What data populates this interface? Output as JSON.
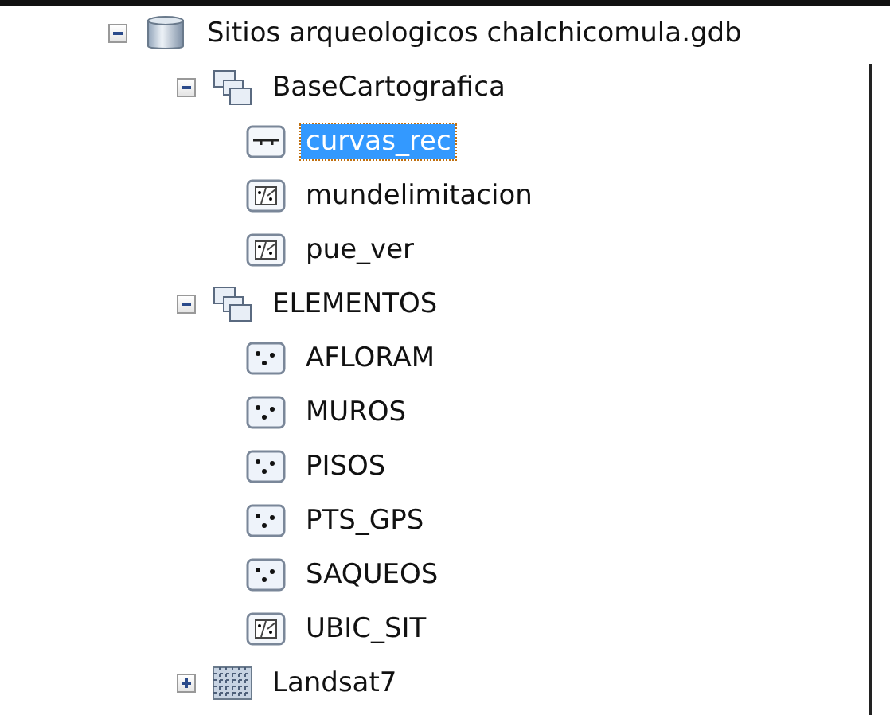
{
  "tree": [
    {
      "label": "Sitios arqueologicos chalchicomula.gdb",
      "kind": "database",
      "expanded": true,
      "selected": false,
      "children": [
        {
          "label": "BaseCartografica",
          "kind": "dataset",
          "expanded": true,
          "selected": false,
          "children": [
            {
              "label": "curvas_rec",
              "kind": "line",
              "selected": true
            },
            {
              "label": "mundelimitacion",
              "kind": "polygon",
              "selected": false
            },
            {
              "label": "pue_ver",
              "kind": "polygon",
              "selected": false
            }
          ]
        },
        {
          "label": "ELEMENTOS",
          "kind": "dataset",
          "expanded": true,
          "selected": false,
          "children": [
            {
              "label": "AFLORAM",
              "kind": "point",
              "selected": false
            },
            {
              "label": "MUROS",
              "kind": "point",
              "selected": false
            },
            {
              "label": "PISOS",
              "kind": "point",
              "selected": false
            },
            {
              "label": "PTS_GPS",
              "kind": "point",
              "selected": false
            },
            {
              "label": "SAQUEOS",
              "kind": "point",
              "selected": false
            },
            {
              "label": "UBIC_SIT",
              "kind": "polygon",
              "selected": false
            }
          ]
        },
        {
          "label": "Landsat7",
          "kind": "raster",
          "expanded": false,
          "selected": false
        }
      ]
    }
  ]
}
